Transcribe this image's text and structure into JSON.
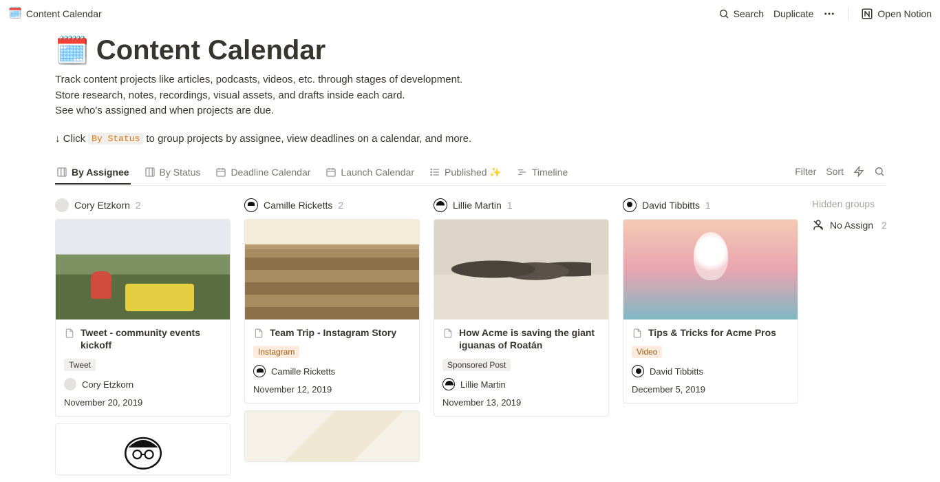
{
  "topbar": {
    "title": "Content Calendar",
    "search": "Search",
    "duplicate": "Duplicate",
    "open_notion": "Open Notion"
  },
  "header": {
    "emoji": "📅",
    "title": "Content Calendar",
    "desc_line1": "Track content projects like articles, podcasts, videos, etc. through stages of development.",
    "desc_line2": "Store research, notes, recordings, visual assets, and drafts inside each card.",
    "desc_line3": "See who's assigned and when projects are due.",
    "hint_prefix": "↓ Click",
    "hint_chip": "By Status",
    "hint_suffix": "to group projects by assignee, view deadlines on a calendar, and more."
  },
  "tabs": [
    {
      "label": "By Assignee",
      "icon": "board",
      "active": true
    },
    {
      "label": "By Status",
      "icon": "board",
      "active": false
    },
    {
      "label": "Deadline Calendar",
      "icon": "calendar",
      "active": false
    },
    {
      "label": "Launch Calendar",
      "icon": "calendar",
      "active": false
    },
    {
      "label": "Published ✨",
      "icon": "list",
      "active": false
    },
    {
      "label": "Timeline",
      "icon": "timeline",
      "active": false
    }
  ],
  "tabs_actions": {
    "filter": "Filter",
    "sort": "Sort"
  },
  "columns": [
    {
      "assignee": "Cory Etzkorn",
      "avatar": "ce",
      "count": "2",
      "cards": [
        {
          "cover": "crowd",
          "title": "Tweet - community events kickoff",
          "tag": {
            "label": "Tweet",
            "style": "default"
          },
          "person": {
            "name": "Cory Etzkorn",
            "avatar": "ce"
          },
          "date": "November 20, 2019"
        },
        {
          "cover": "face",
          "partial": true
        }
      ]
    },
    {
      "assignee": "Camille Ricketts",
      "avatar": "cr",
      "count": "2",
      "cards": [
        {
          "cover": "building",
          "title": "Team Trip - Instagram Story",
          "tag": {
            "label": "Instagram",
            "style": "orange"
          },
          "person": {
            "name": "Camille Ricketts",
            "avatar": "cr"
          },
          "date": "November 12, 2019"
        },
        {
          "cover": "paper",
          "partial": true
        }
      ]
    },
    {
      "assignee": "Lillie Martin",
      "avatar": "lm",
      "count": "1",
      "cards": [
        {
          "cover": "iguanas",
          "title": "How Acme is saving the giant iguanas of Roatán",
          "tag": {
            "label": "Sponsored Post",
            "style": "default"
          },
          "person": {
            "name": "Lillie Martin",
            "avatar": "lm"
          },
          "date": "November 13, 2019"
        }
      ]
    },
    {
      "assignee": "David Tibbitts",
      "avatar": "dt",
      "count": "1",
      "cards": [
        {
          "cover": "bulb",
          "title": "Tips & Tricks for Acme Pros",
          "tag": {
            "label": "Video",
            "style": "orange"
          },
          "person": {
            "name": "David Tibbitts",
            "avatar": "dt"
          },
          "date": "December 5, 2019"
        }
      ]
    }
  ],
  "hidden": {
    "title": "Hidden groups",
    "items": [
      {
        "label": "No Assign",
        "count": "2"
      }
    ]
  }
}
